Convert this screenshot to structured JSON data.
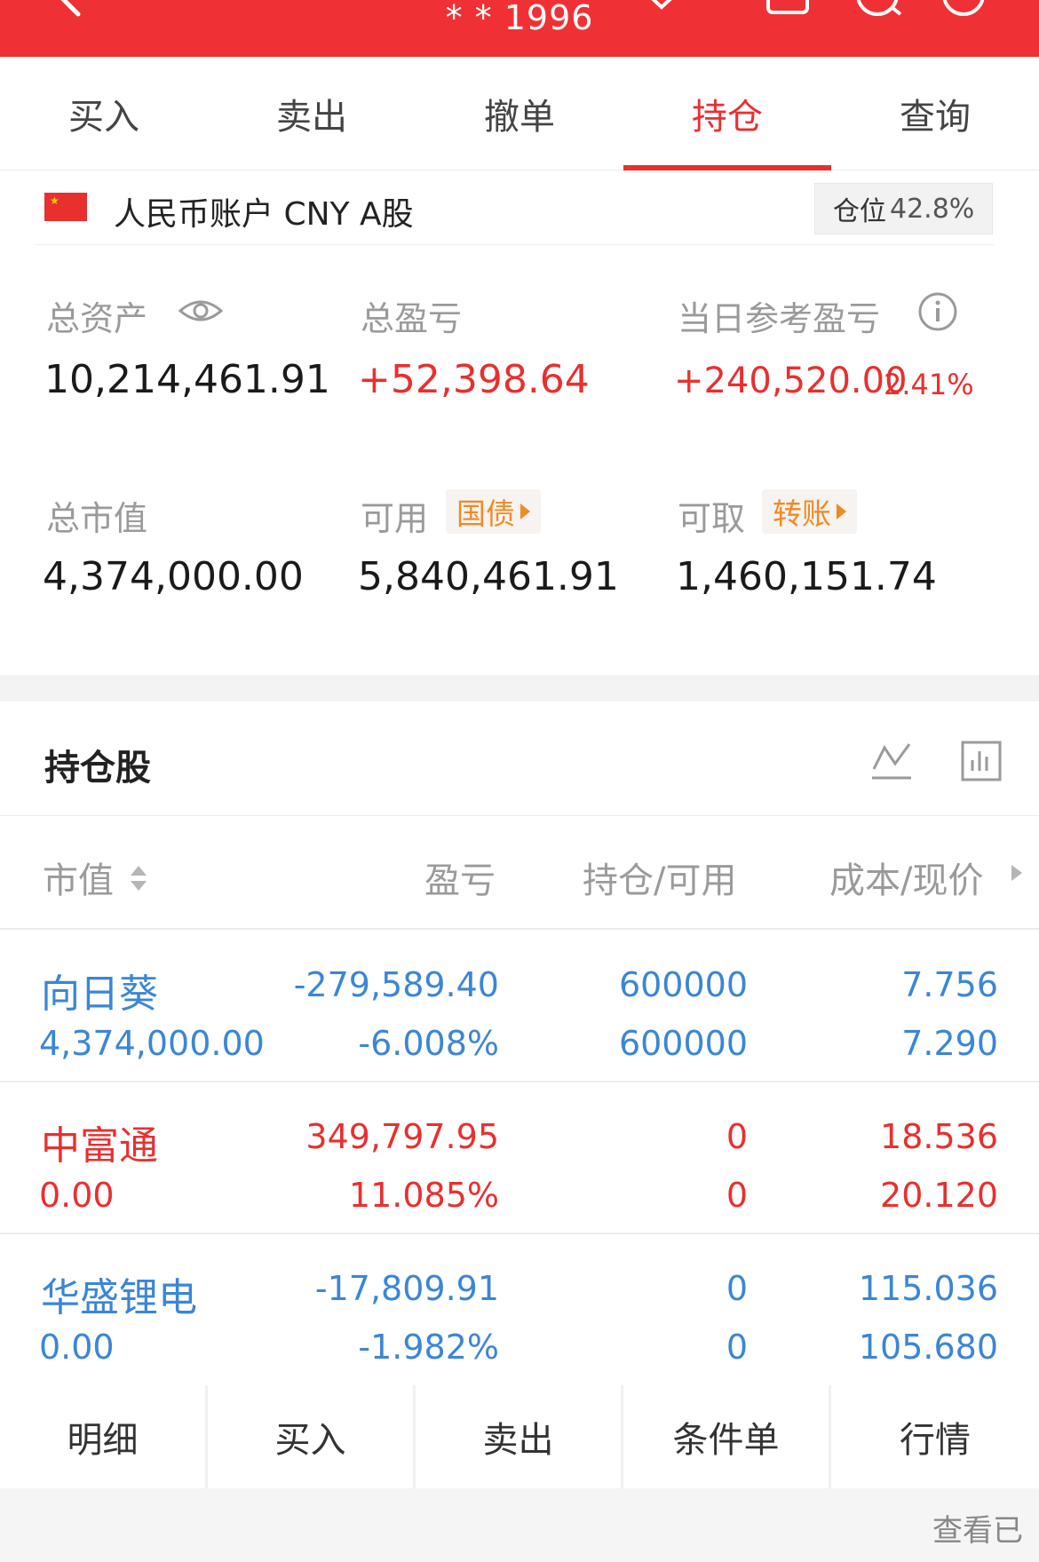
{
  "header": {
    "title": "* * 1996"
  },
  "tabs": [
    {
      "label": "买入"
    },
    {
      "label": "卖出"
    },
    {
      "label": "撤单"
    },
    {
      "label": "持仓"
    },
    {
      "label": "查询"
    }
  ],
  "account": {
    "name": "人民币账户 CNY A股",
    "position_label": "仓位",
    "position_value": "42.8%"
  },
  "summary": {
    "total_assets_label": "总资产",
    "total_assets": "10,214,461.91",
    "total_pnl_label": "总盈亏",
    "total_pnl": "+52,398.64",
    "daily_pnl_label": "当日参考盈亏",
    "daily_pnl": "+240,520.00",
    "daily_pnl_pct": "2.41%",
    "market_value_label": "总市值",
    "market_value": "4,374,000.00",
    "available_label": "可用",
    "available_tag": "国债",
    "available": "5,840,461.91",
    "withdrawable_label": "可取",
    "withdrawable_tag": "转账",
    "withdrawable": "1,460,151.74"
  },
  "holdings": {
    "title": "持仓股",
    "columns": [
      "市值",
      "盈亏",
      "持仓/可用",
      "成本/现价"
    ],
    "rows": [
      {
        "name": "向日葵",
        "value": "4,374,000.00",
        "pnl": "-279,589.40",
        "pnl_pct": "-6.008%",
        "hold": "600000",
        "avail": "600000",
        "cost": "7.756",
        "price": "7.290"
      },
      {
        "name": "中富通",
        "value": "0.00",
        "pnl": "349,797.95",
        "pnl_pct": "11.085%",
        "hold": "0",
        "avail": "0",
        "cost": "18.536",
        "price": "20.120"
      },
      {
        "name": "华盛锂电",
        "value": "0.00",
        "pnl": "-17,809.91",
        "pnl_pct": "-1.982%",
        "hold": "0",
        "avail": "0",
        "cost": "115.036",
        "price": "105.680"
      }
    ]
  },
  "bottom_bar": [
    "明细",
    "买入",
    "卖出",
    "条件单",
    "行情"
  ],
  "footer": {
    "text": "查看已"
  },
  "colors": {
    "brand_red": "#ef3135",
    "gain": "#e8302f",
    "loss": "#3b86d6",
    "tag_orange": "#f08a24"
  }
}
